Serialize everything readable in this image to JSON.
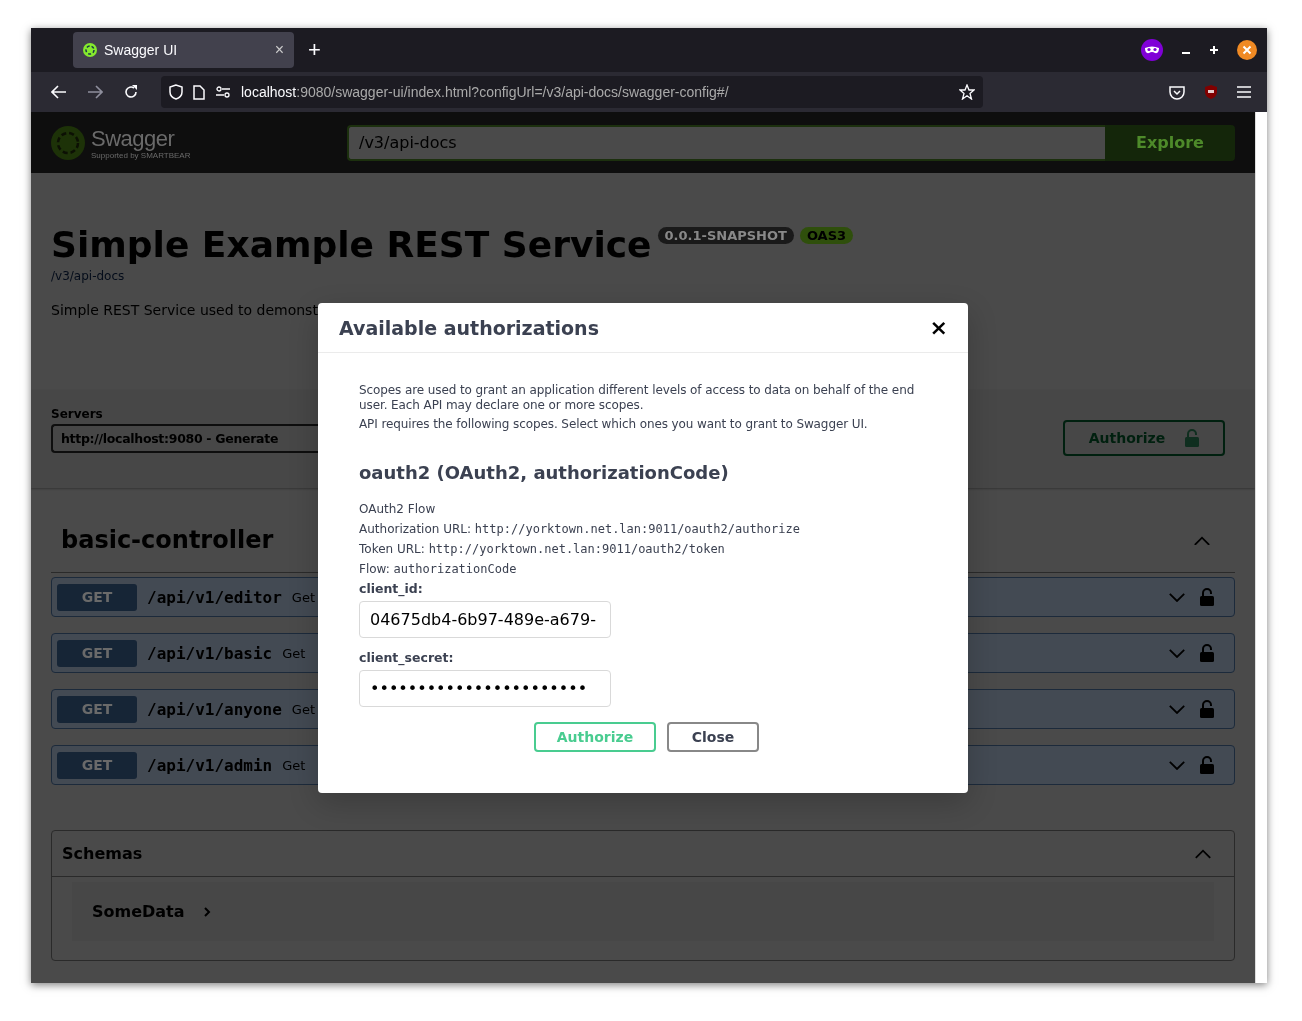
{
  "browser": {
    "tab": {
      "title": "Swagger UI",
      "selected": true,
      "close": "×"
    },
    "new_tab": "+",
    "url": {
      "host": "localhost",
      "rest": ":9080/swagger-ui/index.html?configUrl=/v3/api-docs/swagger-config#/"
    }
  },
  "topbar": {
    "logo_text": "Swagger",
    "logo_sub": "Supported by SMARTBEAR",
    "spec_url": "/v3/api-docs",
    "explore": "Explore"
  },
  "info": {
    "title": "Simple Example REST Service",
    "version": "0.0.1-SNAPSHOT",
    "oas": "OAS3",
    "link": "/v3/api-docs",
    "description": "Simple REST Service used to demonst"
  },
  "servers": {
    "label": "Servers",
    "selected": "http://localhost:9080 - Generate",
    "authorize": "Authorize"
  },
  "tag": {
    "name": "basic-controller",
    "expanded": true,
    "operations": [
      {
        "method": "GET",
        "path": "/api/v1/editor",
        "summary": "Get",
        "expanded": false
      },
      {
        "method": "GET",
        "path": "/api/v1/basic",
        "summary": "Get",
        "expanded": false
      },
      {
        "method": "GET",
        "path": "/api/v1/anyone",
        "summary": "Get",
        "expanded": false
      },
      {
        "method": "GET",
        "path": "/api/v1/admin",
        "summary": "Get",
        "expanded": false
      }
    ]
  },
  "schemas": {
    "title": "Schemas",
    "expanded": true,
    "models": [
      {
        "name": "SomeData",
        "expanded": false
      }
    ]
  },
  "modal": {
    "title": "Available authorizations",
    "close": "×",
    "paragraphs": [
      "Scopes are used to grant an application different levels of access to data on behalf of the end user. Each API may declare one or more scopes.",
      "API requires the following scopes. Select which ones you want to grant to Swagger UI."
    ],
    "scheme": "oauth2 (OAuth2, authorizationCode)",
    "flow_title": "OAuth2 Flow",
    "flow_lines": [
      {
        "label": "Authorization URL:",
        "value": "http://yorktown.net.lan:9011/oauth2/authorize"
      },
      {
        "label": "Token URL:",
        "value": "http://yorktown.net.lan:9011/oauth2/token"
      },
      {
        "label": "Flow:",
        "value": "authorizationCode"
      }
    ],
    "fields": [
      {
        "label": "client_id:",
        "value": "04675db4-6b97-489e-a679-"
      },
      {
        "label": "client_secret:",
        "value": "•••••••••••••••••••••••"
      }
    ],
    "buttons": [
      {
        "label": "Authorize",
        "kind": "primary"
      },
      {
        "label": "Close",
        "kind": "secondary"
      }
    ]
  }
}
